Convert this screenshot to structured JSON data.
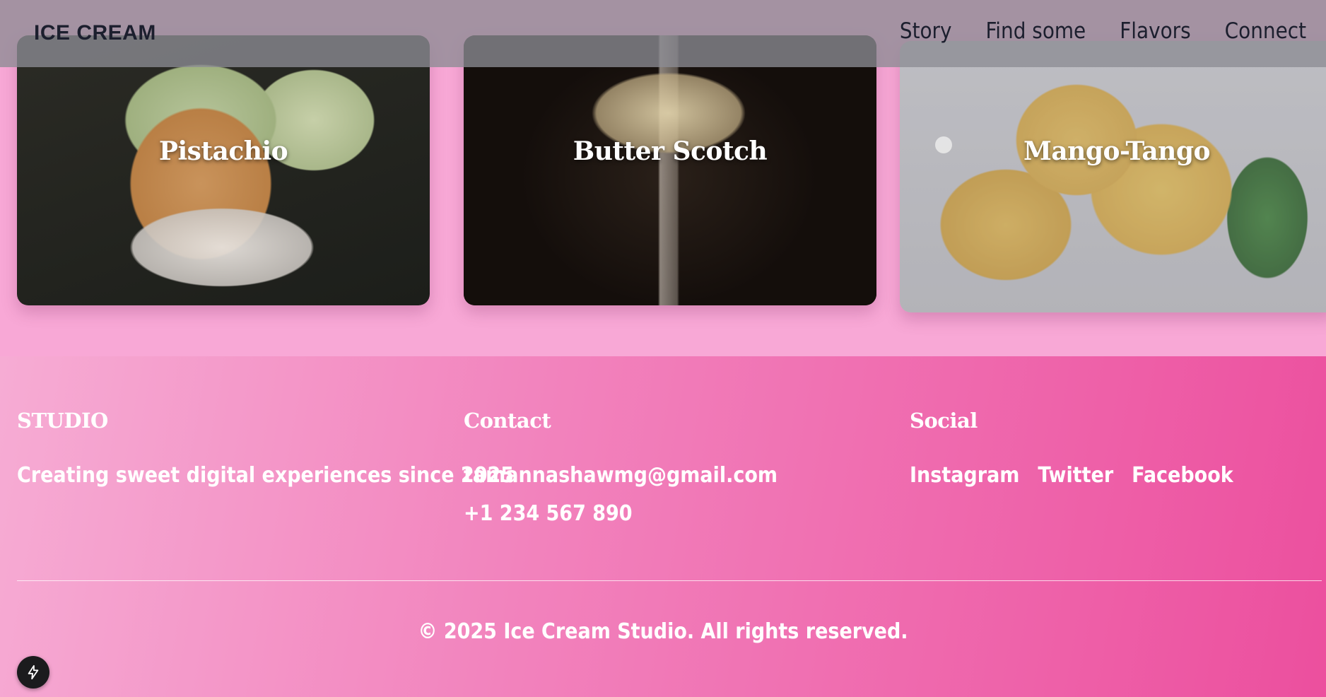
{
  "header": {
    "brand": "ICE CREAM",
    "nav": [
      "Story",
      "Find some",
      "Flavors",
      "Connect"
    ]
  },
  "cards": [
    {
      "title": "Pistachio"
    },
    {
      "title": "Butter Scotch"
    },
    {
      "title": "Mango-Tango"
    }
  ],
  "footer": {
    "studio": {
      "heading": "STUDIO",
      "tagline": "Creating sweet digital experiences since 2025"
    },
    "contact": {
      "heading": "Contact",
      "email": "tamannashawmg@gmail.com",
      "phone": "+1 234 567 890"
    },
    "social": {
      "heading": "Social",
      "links": [
        "Instagram",
        "Twitter",
        "Facebook"
      ]
    },
    "copyright": "© 2025 Ice Cream Studio. All rights reserved."
  },
  "icons": {
    "badge": "lightning-bolt-icon"
  },
  "colors": {
    "footer_start": "#f6acd4",
    "footer_end": "#ec4f9e",
    "page_bg": "#f8a8d6"
  }
}
